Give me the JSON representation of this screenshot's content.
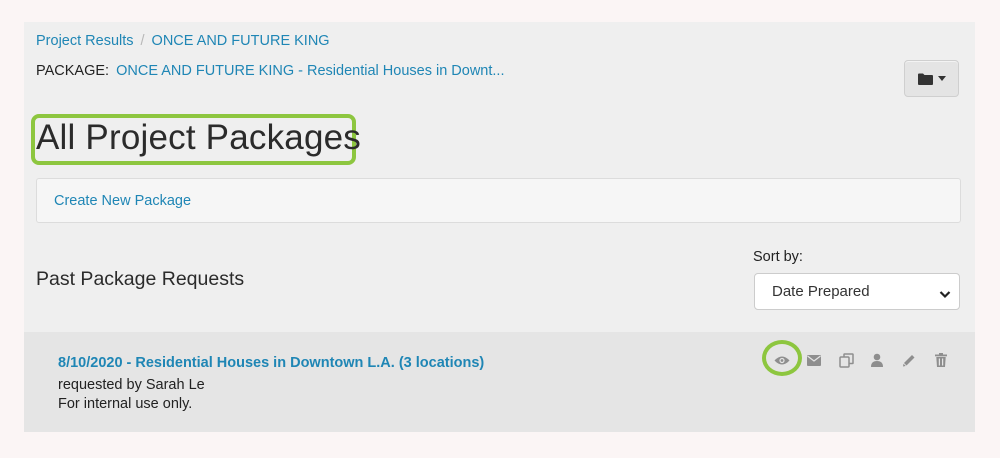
{
  "breadcrumb": {
    "items": [
      "Project Results",
      "ONCE AND FUTURE KING"
    ],
    "separator": "/"
  },
  "package": {
    "prefix": "PACKAGE:",
    "link": "ONCE AND FUTURE KING - Residential Houses in Downt..."
  },
  "toolbar": {
    "folder_icon": "folder-icon",
    "caret_icon": "caret-down-icon"
  },
  "page_title": "All Project Packages",
  "create_link": "Create New Package",
  "section_title": "Past Package Requests",
  "sort": {
    "label": "Sort by:",
    "selected": "Date Prepared"
  },
  "requests": [
    {
      "title": "8/10/2020 - Residential Houses in Downtown L.A. (3 locations)",
      "requested_by": "requested by Sarah Le",
      "note": "For internal use only.",
      "actions": [
        "eye-icon",
        "envelope-icon",
        "copy-icon",
        "user-icon",
        "pencil-icon",
        "trash-icon"
      ]
    }
  ],
  "colors": {
    "link": "#1f86b5",
    "highlight": "#8dc63f",
    "icon": "#8e8e8e",
    "panel": "#efefef",
    "row": "#e5e5e5"
  }
}
